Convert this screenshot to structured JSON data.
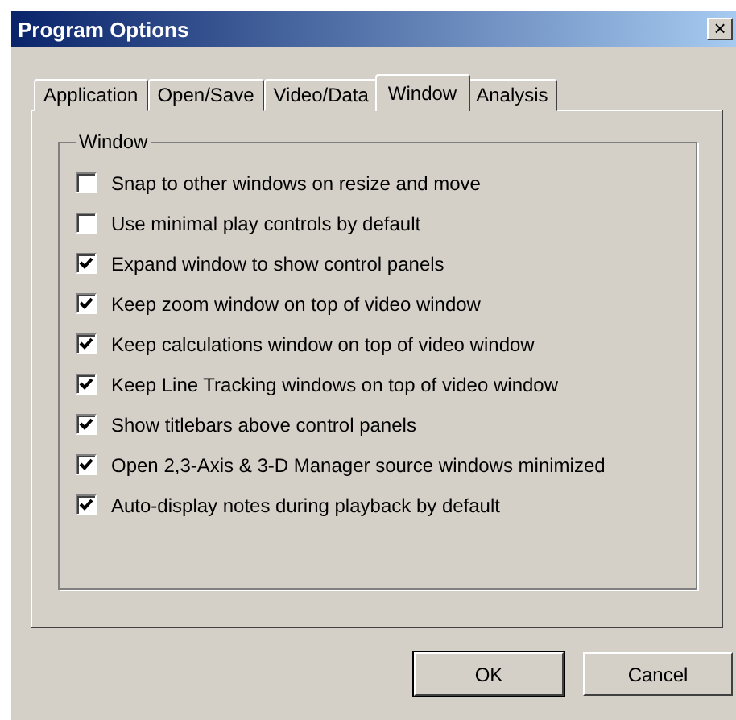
{
  "window": {
    "title": "Program Options",
    "close": "×"
  },
  "tabs": [
    {
      "label": "Application",
      "selected": false
    },
    {
      "label": "Open/Save",
      "selected": false
    },
    {
      "label": "Video/Data",
      "selected": false
    },
    {
      "label": "Window",
      "selected": true
    },
    {
      "label": "Analysis",
      "selected": false
    }
  ],
  "group": {
    "title": "Window",
    "options": [
      {
        "label": "Snap to other windows on resize and move",
        "checked": false
      },
      {
        "label": "Use minimal play controls by default",
        "checked": false
      },
      {
        "label": "Expand window to show control panels",
        "checked": true
      },
      {
        "label": "Keep zoom window on top of video window",
        "checked": true
      },
      {
        "label": "Keep calculations window on top of video window",
        "checked": true
      },
      {
        "label": "Keep Line Tracking windows on top of video window",
        "checked": true
      },
      {
        "label": "Show titlebars above control panels",
        "checked": true
      },
      {
        "label": "Open 2,3-Axis & 3-D Manager source windows minimized",
        "checked": true
      },
      {
        "label": "Auto-display notes during playback by default",
        "checked": true
      }
    ]
  },
  "buttons": [
    {
      "label": "OK",
      "default": true
    },
    {
      "label": "Cancel",
      "default": false
    }
  ]
}
